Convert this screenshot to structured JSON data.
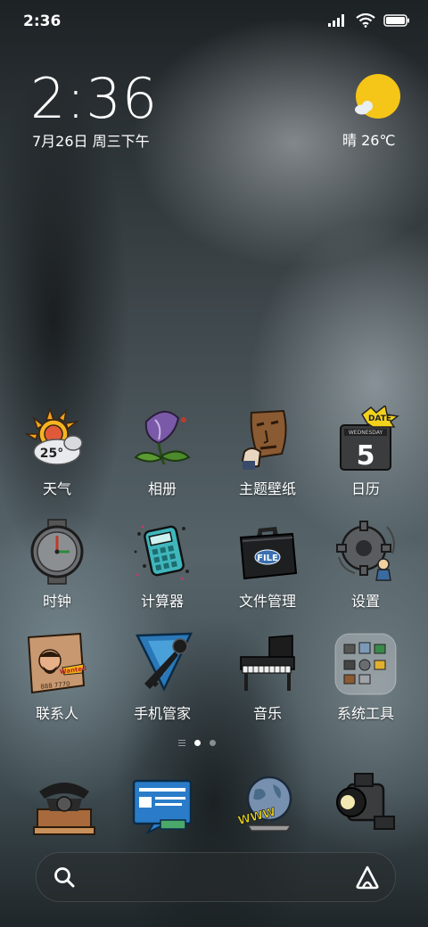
{
  "status_bar": {
    "time": "2:36"
  },
  "clock_widget": {
    "time": "2:36",
    "date": "7月26日 周三下午"
  },
  "weather_widget": {
    "text": "晴 26℃"
  },
  "apps": [
    {
      "label": "天气",
      "icon": "weather-icon",
      "badge": "25°"
    },
    {
      "label": "相册",
      "icon": "gallery-flower-icon"
    },
    {
      "label": "主题壁纸",
      "icon": "theme-mask-icon"
    },
    {
      "label": "日历",
      "icon": "calendar-icon",
      "date_tag": "DATE",
      "weekday": "WEDNESDAY",
      "day": "5"
    },
    {
      "label": "时钟",
      "icon": "clock-icon"
    },
    {
      "label": "计算器",
      "icon": "calculator-icon"
    },
    {
      "label": "文件管理",
      "icon": "file-briefcase-icon",
      "tag": "FILE"
    },
    {
      "label": "设置",
      "icon": "gear-icon"
    },
    {
      "label": "联系人",
      "icon": "wanted-poster-icon",
      "tag": "Wanted",
      "number": "888 7770"
    },
    {
      "label": "手机管家",
      "icon": "key-shield-icon"
    },
    {
      "label": "音乐",
      "icon": "piano-icon"
    },
    {
      "label": "系统工具",
      "icon": "system-tools-folder-icon"
    }
  ],
  "dock": [
    {
      "icon": "telephone-icon"
    },
    {
      "icon": "message-icon"
    },
    {
      "icon": "browser-globe-icon",
      "tag": "WWW"
    },
    {
      "icon": "camera-icon"
    }
  ],
  "page_indicator": {
    "pages": 2,
    "current": 1
  },
  "search": {
    "icon": "search-icon",
    "assistant_icon": "assistant-a-icon"
  }
}
